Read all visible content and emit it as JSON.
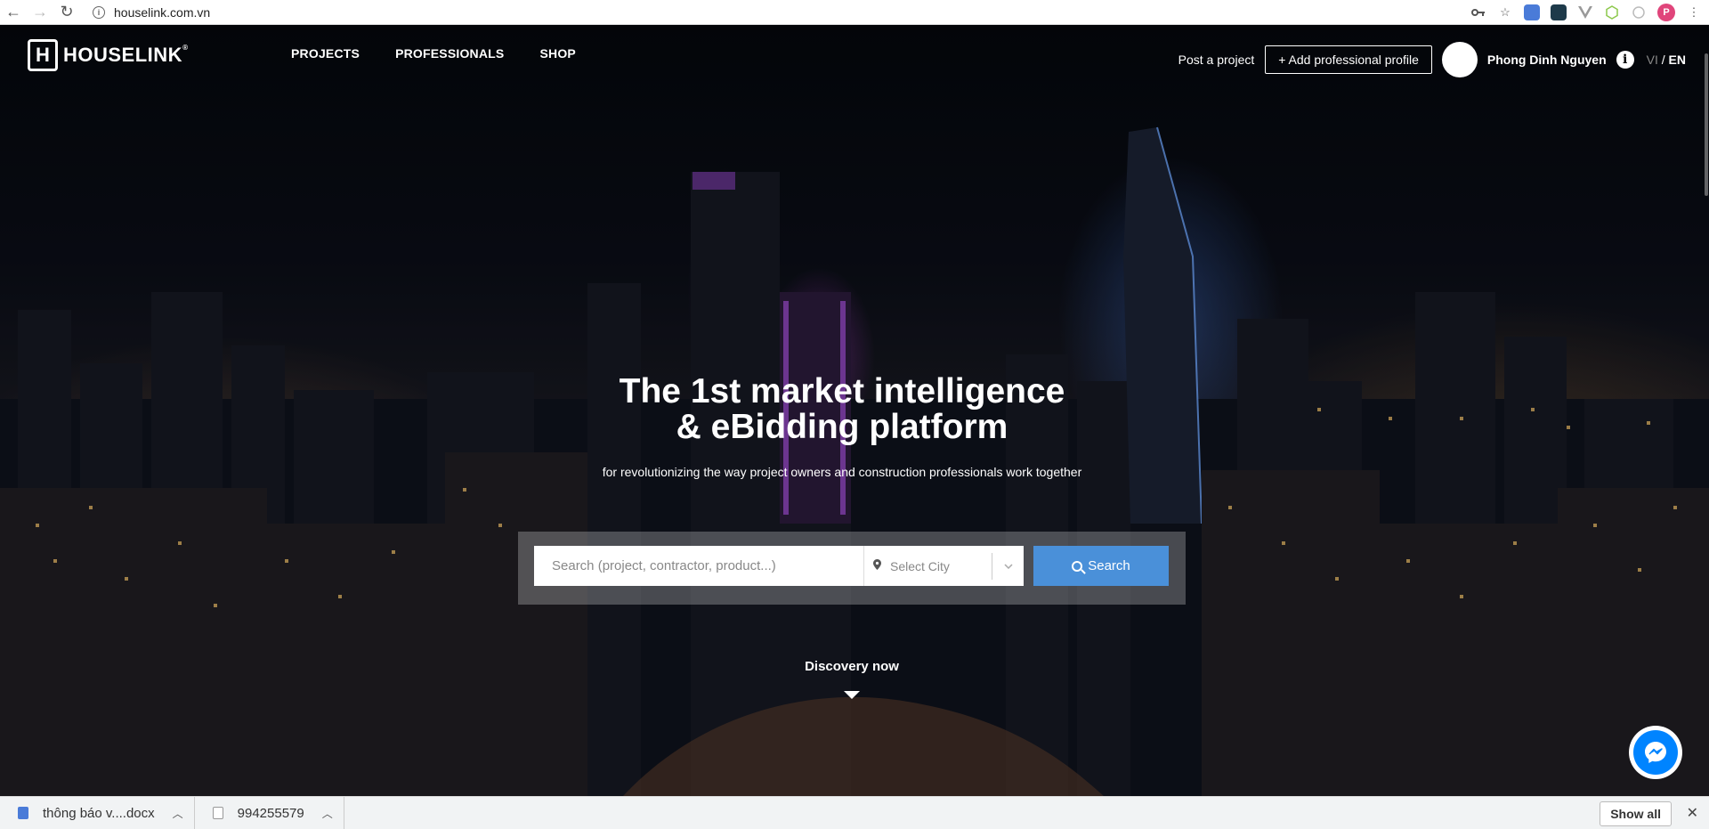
{
  "browser": {
    "url": "houselink.com.vn",
    "back_icon": "←",
    "forward_icon": "→",
    "reload_icon": "↻",
    "profile_initial": "P"
  },
  "header": {
    "logo_mark": "H",
    "logo_text": "HOUSELINK",
    "logo_reg": "®",
    "nav": [
      "PROJECTS",
      "PROFESSIONALS",
      "SHOP"
    ],
    "post_project": "Post a project",
    "add_profile": "+ Add professional profile",
    "user_name": "Phong Dinh Nguyen",
    "info_glyph": "i",
    "lang_vi": "VI",
    "lang_sep": " / ",
    "lang_en": "EN"
  },
  "hero": {
    "title_line1": "The 1st market intelligence",
    "title_line2": "& eBidding platform",
    "subtitle": "for revolutionizing the way project owners and construction professionals work together",
    "search_placeholder": "Search (project, contractor, product...)",
    "city_placeholder": "Select City",
    "search_button": "Search",
    "discovery": "Discovery now"
  },
  "downloads": {
    "items": [
      {
        "name": "thông báo v....docx"
      },
      {
        "name": "994255579"
      }
    ],
    "show_all": "Show all",
    "close": "✕"
  },
  "colors": {
    "accent": "#4a90d9",
    "messenger": "#0084ff"
  }
}
